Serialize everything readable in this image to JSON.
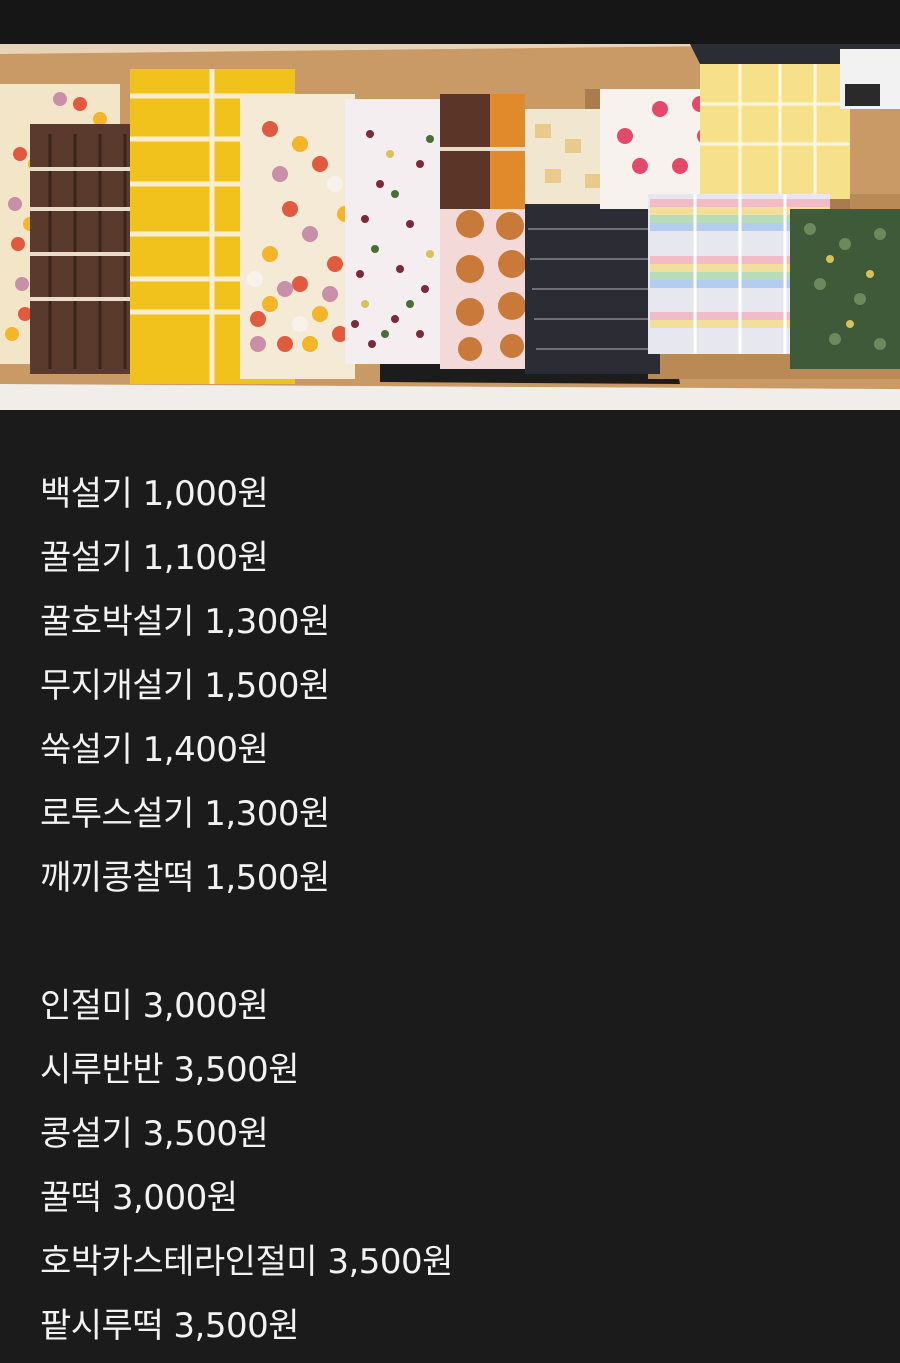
{
  "photo": {
    "description_icon": "rice-cake-table-photo"
  },
  "menu": {
    "group1": [
      "백설기 1,000원",
      "꿀설기 1,100원",
      "꿀호박설기 1,300원",
      "무지개설기 1,500원",
      "쑥설기 1,400원",
      "로투스설기 1,300원",
      "깨끼콩찰떡 1,500원"
    ],
    "group2": [
      "인절미 3,000원",
      "시루반반 3,500원",
      "콩설기 3,500원",
      "꿀떡 3,000원",
      "호박카스테라인절미 3,500원",
      "팥시루떡 3,500원"
    ]
  },
  "colors": {
    "background": "#1b1b1b",
    "text": "#f2f2f2"
  }
}
